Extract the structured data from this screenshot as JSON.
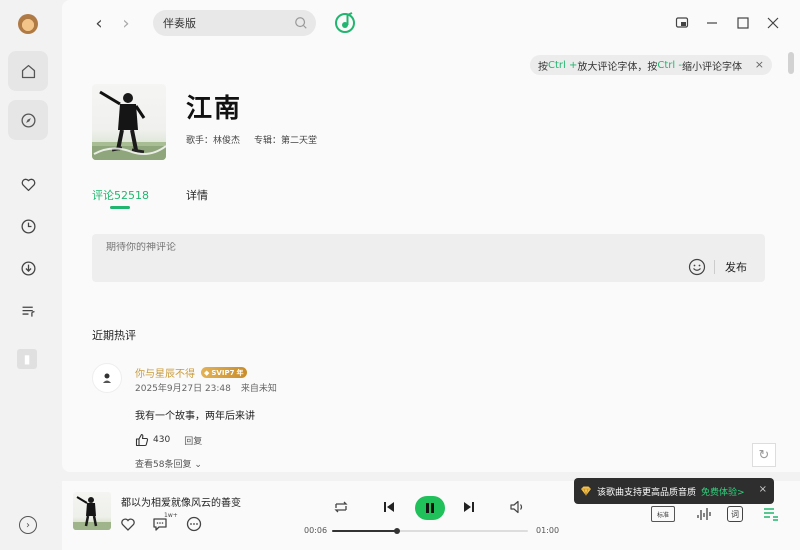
{
  "search": {
    "value": "伴奏版"
  },
  "hint": {
    "prefix": "按 ",
    "key1": "Ctrl +",
    "mid": " 放大评论字体，按 ",
    "key2": "Ctrl -",
    "suffix": " 缩小评论字体",
    "close": "×"
  },
  "song": {
    "title": "江南",
    "singer": "歌手：林俊杰",
    "album": "专辑：第二天堂"
  },
  "tabs": {
    "comments": "评论52518",
    "details": "详情"
  },
  "comment_input": {
    "placeholder": "期待你的神评论",
    "send_label": "发布"
  },
  "section_title": "近期热评",
  "comment": {
    "user": "你与星辰不得",
    "vip": "SVIP7",
    "vip_suffix": "年",
    "date": "2025年9月27日 23:48",
    "location": "来自未知",
    "text": "我有一个故事，两年后来讲",
    "likes": "430",
    "reply_label": "回复",
    "more": "查看58条回复"
  },
  "player": {
    "now_playing": "都以为相爱就像风云的善变",
    "time_current": "00:06",
    "time_total": "01:00",
    "progress": 0.33,
    "quality": "标准",
    "lyrics_label": "词",
    "comment_badge": "1w+"
  },
  "tooltip": {
    "text": "该歌曲支持更高品质音质",
    "link": "免费体验>",
    "close": "×"
  },
  "colors": {
    "accent": "#21b66f",
    "play": "#20c05a",
    "vip": "#c99a3a"
  }
}
